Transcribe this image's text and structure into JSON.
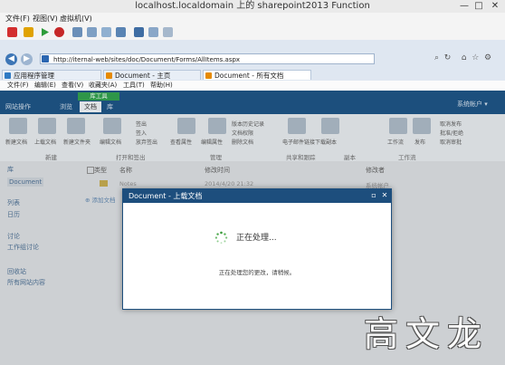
{
  "vm": {
    "title": "localhost.localdomain 上的 sharepoint2013 Function",
    "menu": [
      "文件(F)",
      "视图(V)",
      "虚拟机(V)"
    ],
    "controls": {
      "minimize": "—",
      "maximize": "□",
      "close": "✕"
    }
  },
  "browser": {
    "url": "http://iternal-web/sites/doc/Document/Forms/AllItems.aspx",
    "tabs": [
      {
        "label": "应用程序管理",
        "active": false
      },
      {
        "label": "Document - 主页",
        "active": false
      },
      {
        "label": "Document - 所有文档",
        "active": true
      }
    ],
    "menu": [
      "文件(F)",
      "编辑(E)",
      "查看(V)",
      "收藏夹(A)",
      "工具(T)",
      "帮助(H)"
    ]
  },
  "sharepoint": {
    "ribbon_tabs": [
      "网站操作",
      "浏览",
      "文档",
      "库"
    ],
    "tool_tab": "库工具",
    "user": "系统帐户",
    "ribbon_buttons": [
      "新建文档",
      "上载文档",
      "新建文件夹",
      "编辑文档",
      "签出",
      "签入",
      "放弃签出",
      "查看属性",
      "编辑属性",
      "版本历史记录",
      "文档权限",
      "删除文档",
      "电子邮件链接",
      "下载副本",
      "工作流",
      "发布",
      "取消发布",
      "批准/拒绝",
      "取消审批"
    ],
    "ribbon_groups": [
      "新建",
      "打开和签出",
      "管理",
      "共享和跟踪",
      "副本",
      "工作流"
    ],
    "nav": [
      "库",
      "Document",
      "列表",
      "日历",
      "讨论",
      "工作组讨论",
      "回收站",
      "所有网站内容"
    ],
    "list_headers": [
      "类型",
      "名称",
      "修改时间",
      "修改者"
    ],
    "list_rows": [
      {
        "name": "Notes",
        "modified": "2014/4/20 21:32",
        "by": "系统帐户"
      }
    ],
    "add_document": "添加文档"
  },
  "dialog": {
    "title": "Document - 上载文档",
    "processing": "正在处理...",
    "subtext": "正在处理您的更改，请稍候。"
  },
  "watermark": "高文龙"
}
